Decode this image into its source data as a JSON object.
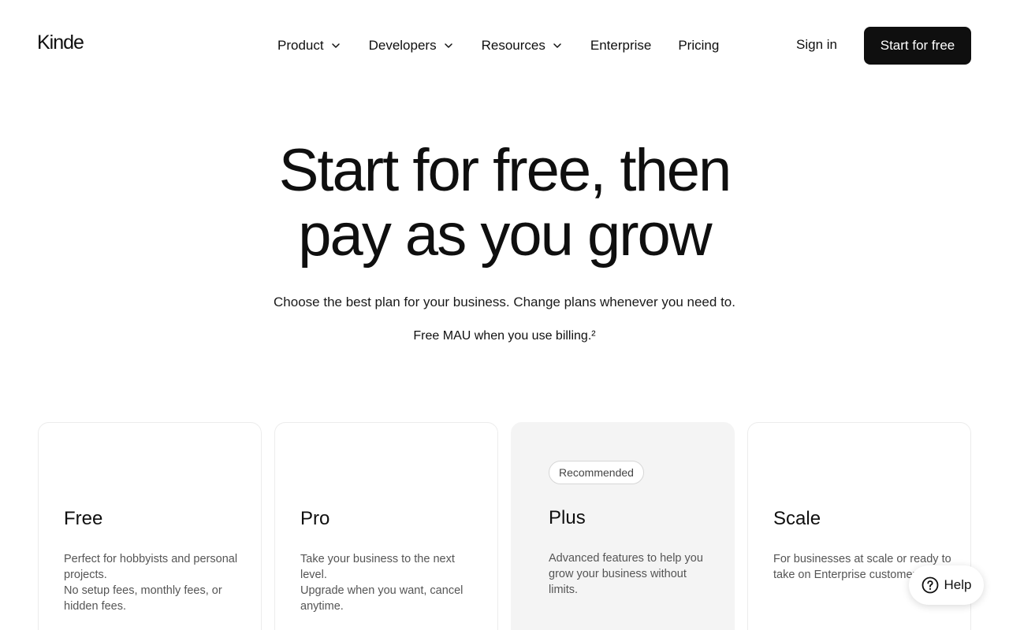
{
  "header": {
    "logo": "Kinde",
    "nav": {
      "product": "Product",
      "developers": "Developers",
      "resources": "Resources",
      "enterprise": "Enterprise",
      "pricing": "Pricing"
    },
    "sign_in": "Sign in",
    "cta": "Start for free"
  },
  "hero": {
    "title_line1": "Start for free, then",
    "title_line2": "pay as you grow",
    "subtitle": "Choose the best plan for your business. Change plans whenever you need to.",
    "note": "Free MAU when you use billing.²"
  },
  "plans": {
    "free": {
      "name": "Free",
      "desc_line1": "Perfect for hobbyists and personal projects.",
      "desc_line2": "No setup fees, monthly fees, or hidden fees."
    },
    "pro": {
      "name": "Pro",
      "desc_line1": "Take your business to the next level.",
      "desc_line2": "Upgrade when you want, cancel anytime."
    },
    "plus": {
      "badge": "Recommended",
      "name": "Plus",
      "desc_line1": "Advanced features to help you grow your business without limits."
    },
    "scale": {
      "name": "Scale",
      "desc_line1": "For businesses at scale or ready to take on Enterprise customers."
    }
  },
  "help": {
    "label": "Help",
    "icon": "question-circle-icon"
  },
  "colors": {
    "primary": "#0f0f0f",
    "background": "#ffffff",
    "recommended_card": "#f4f4f4"
  }
}
